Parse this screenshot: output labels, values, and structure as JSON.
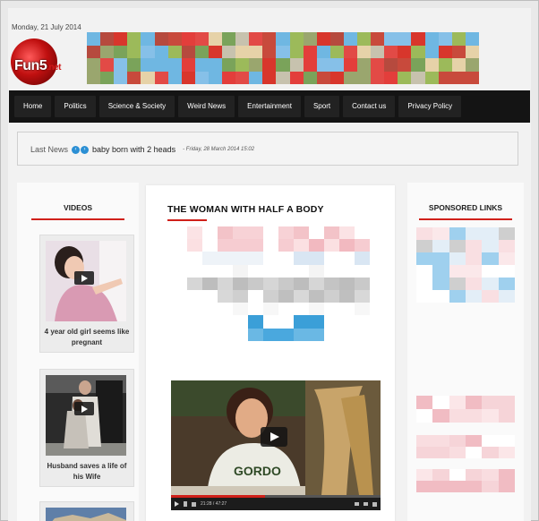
{
  "header": {
    "date": "Monday, 21 July 2014",
    "logo_text": "Fun5",
    "logo_tld": ".net"
  },
  "nav": {
    "items": [
      "Home",
      "Politics",
      "Science & Society",
      "Weird News",
      "Entertainment",
      "Sport",
      "Contact us",
      "Privacy Policy"
    ]
  },
  "ticker": {
    "label": "Last News",
    "headline": "baby born with 2 heads",
    "timestamp": "- Friday, 28 March 2014 15:02"
  },
  "videos": {
    "title": "VIDEOS",
    "items": [
      {
        "caption": "4 year old girl seems like pregnant"
      },
      {
        "caption": "Husband saves a life of his Wife"
      }
    ]
  },
  "article": {
    "title": "THE WOMAN WITH HALF A BODY",
    "player": {
      "time": "21:28 / 47:27",
      "progress": 0.45
    }
  },
  "sponsored": {
    "title": "SPONSORED LINKS"
  },
  "colors": {
    "accent": "#d0201a",
    "nav_bg": "#141414",
    "link_blue": "#2b8fd4"
  }
}
